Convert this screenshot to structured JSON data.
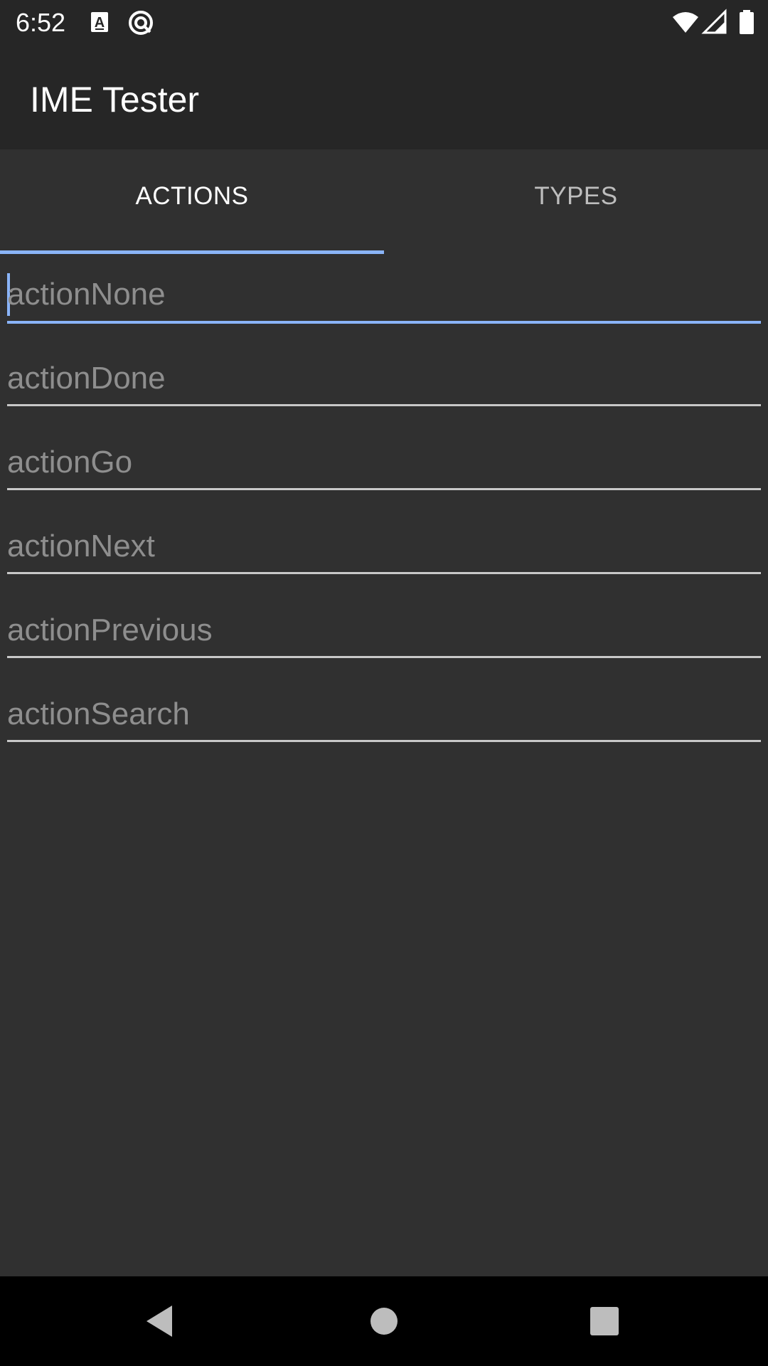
{
  "status_bar": {
    "time": "6:52",
    "left_icons": [
      "autofill-a-icon",
      "sync-circle-icon"
    ],
    "right_icons": [
      "wifi-icon",
      "cell-signal-icon",
      "battery-icon"
    ]
  },
  "app_bar": {
    "title": "IME Tester"
  },
  "tabs": [
    {
      "label": "ACTIONS",
      "selected": true
    },
    {
      "label": "TYPES",
      "selected": false
    }
  ],
  "fields": [
    {
      "hint": "actionNone",
      "value": "",
      "focused": true
    },
    {
      "hint": "actionDone",
      "value": "",
      "focused": false
    },
    {
      "hint": "actionGo",
      "value": "",
      "focused": false
    },
    {
      "hint": "actionNext",
      "value": "",
      "focused": false
    },
    {
      "hint": "actionPrevious",
      "value": "",
      "focused": false
    },
    {
      "hint": "actionSearch",
      "value": "",
      "focused": false
    }
  ],
  "nav_bar": {
    "buttons": [
      "back-icon",
      "home-icon",
      "recents-icon"
    ]
  },
  "colors": {
    "accent": "#8ab4f8",
    "background": "#303030",
    "bar": "#262626",
    "hint_text": "#8e8e8e"
  }
}
